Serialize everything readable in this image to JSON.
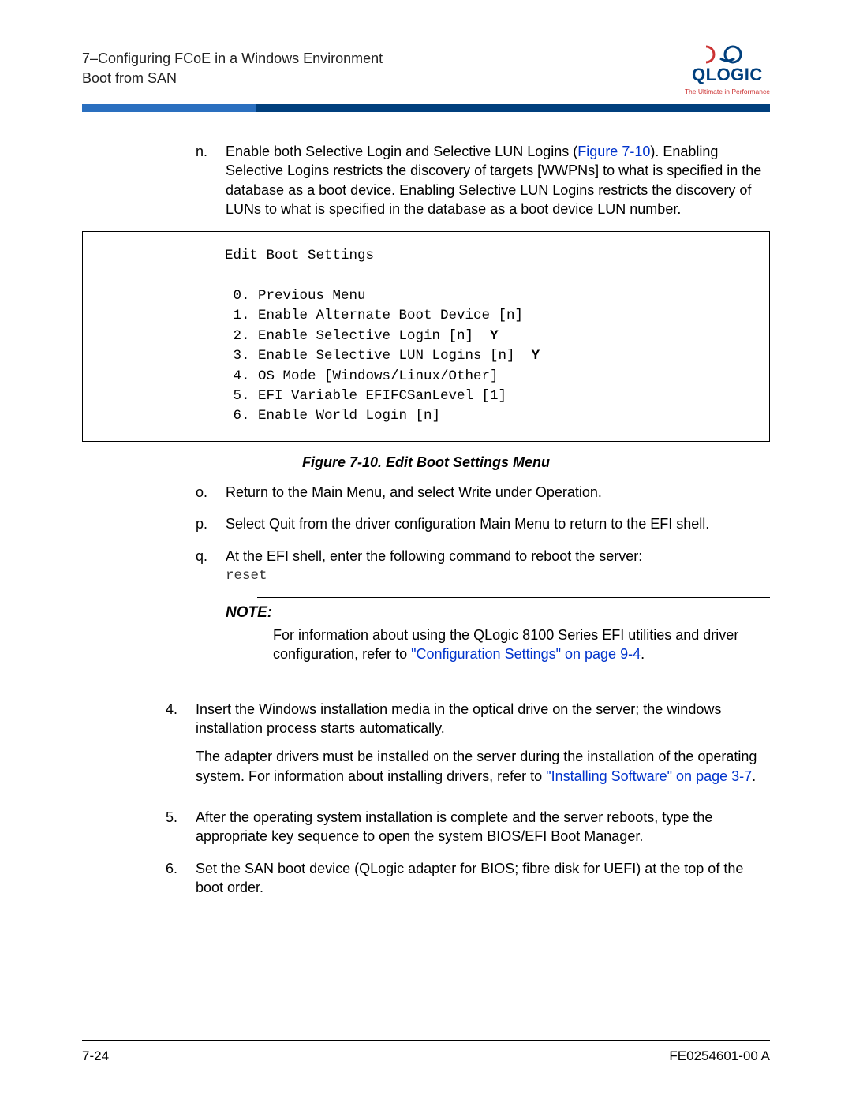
{
  "header": {
    "chapter_line": "7–Configuring FCoE in a Windows Environment",
    "section_line": "Boot from SAN"
  },
  "logo": {
    "name": "QLOGIC",
    "tagline": "The Ultimate in Performance"
  },
  "items": {
    "n": {
      "marker": "n.",
      "text_pre": "Enable both Selective Login and Selective LUN Logins (",
      "link": "Figure 7-10",
      "text_post": "). Enabling Selective Logins restricts the discovery of targets [WWPNs] to what is specified in the database as a boot device. Enabling Selective LUN Logins restricts the discovery of LUNs to what is specified in the database as a boot device LUN number."
    },
    "code": {
      "title": "Edit Boot Settings",
      "l0": " 0. Previous Menu",
      "l1": " 1. Enable Alternate Boot Device [n]",
      "l2a": " 2. Enable Selective Login [n]  ",
      "l2b": "Y",
      "l3a": " 3. Enable Selective LUN Logins [n]  ",
      "l3b": "Y",
      "l4": " 4. OS Mode [Windows/Linux/Other]",
      "l5": " 5. EFI Variable EFIFCSanLevel [1]",
      "l6": " 6. Enable World Login [n]"
    },
    "fig_caption": "Figure 7-10. Edit Boot Settings Menu",
    "o": {
      "marker": "o.",
      "text": "Return to the Main Menu, and select Write under Operation."
    },
    "p": {
      "marker": "p.",
      "text": "Select Quit from the driver configuration Main Menu to return to the EFI shell."
    },
    "q": {
      "marker": "q.",
      "text": "At the EFI shell, enter the following command to reboot the server:",
      "cmd": "reset"
    },
    "note": {
      "label": "NOTE:",
      "pre": "For information about using the QLogic 8100 Series EFI utilities and driver configuration, refer to ",
      "link": "\"Configuration Settings\" on page 9-4",
      "post": "."
    },
    "s4": {
      "marker": "4.",
      "p1": "Insert the Windows installation media in the optical drive on the server; the windows installation process starts automatically.",
      "p2_pre": "The adapter drivers must be installed on the server during the installation of the operating system. For information about installing drivers, refer to ",
      "p2_link": "\"Installing Software\" on page 3-7",
      "p2_post": "."
    },
    "s5": {
      "marker": "5.",
      "text": "After the operating system installation is complete and the server reboots, type the appropriate key sequence to open the system BIOS/EFI Boot Manager."
    },
    "s6": {
      "marker": "6.",
      "text": "Set the SAN boot device (QLogic adapter for BIOS; fibre disk for UEFI) at the top of the boot order."
    }
  },
  "footer": {
    "left": "7-24",
    "right": "FE0254601-00 A"
  }
}
